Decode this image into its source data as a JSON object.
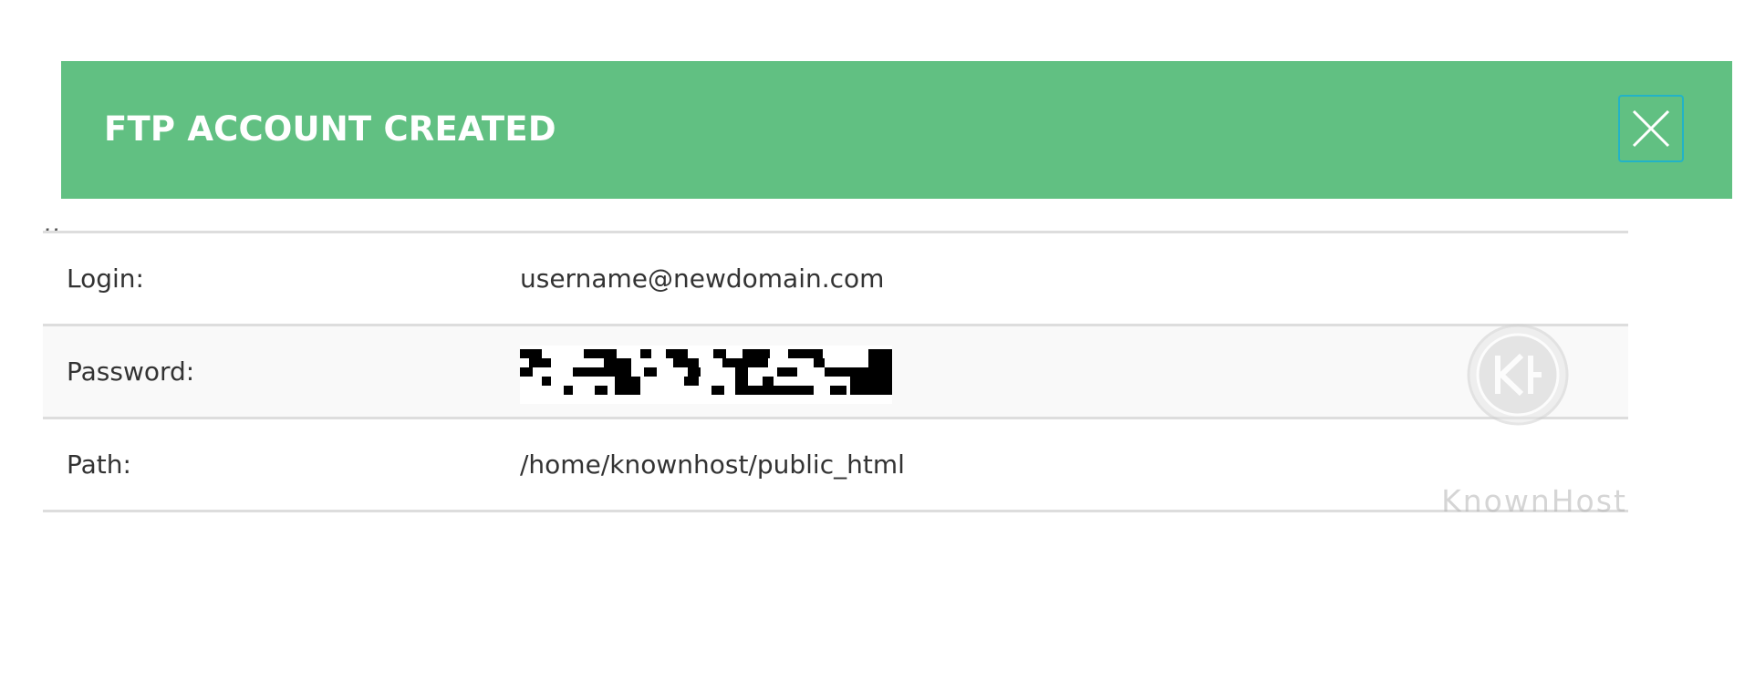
{
  "dialog": {
    "title": "FTP ACCOUNT CREATED",
    "close_icon": "close-icon",
    "header_color": "#61c082",
    "close_border_color": "#22b3c7"
  },
  "intro_text": ",,",
  "details": [
    {
      "label": "Login:",
      "value": "username@newdomain.com"
    },
    {
      "label": "Password:",
      "value": "",
      "redacted": true
    },
    {
      "label": "Path:",
      "value": "/home/knownhost/public_html"
    }
  ],
  "watermark": {
    "logo": "knownhost-logo",
    "text": "KnownHost"
  }
}
